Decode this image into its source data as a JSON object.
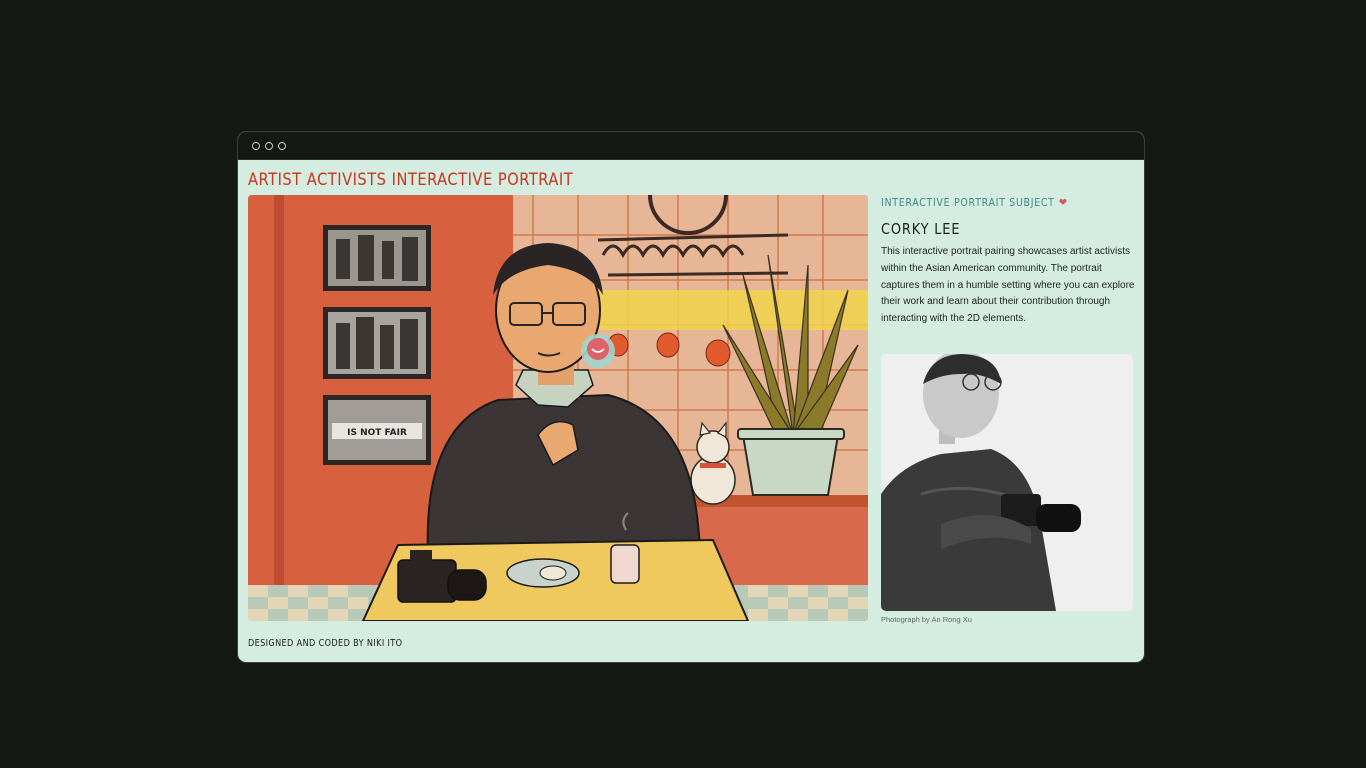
{
  "window": {
    "title": "ARTIST ACTIVISTS INTERACTIVE PORTRAIT",
    "footer": "DESIGNED AND CODED BY NIKI ITO"
  },
  "portrait_illustration": {
    "hotspot_icon": "heart-hotspot-icon",
    "protest_banner_text": "IS NOT FAIR"
  },
  "sidebar": {
    "label": "INTERACTIVE PORTRAIT SUBJECT",
    "label_icon": "heart-icon",
    "name": "CORKY LEE",
    "description": "This interactive portrait pairing showcases artist activists within the Asian American community. The portrait captures them in a humble setting where you can explore their work and learn about their contribution through interacting with the 2D elements.",
    "photo_credit": "Photograph by An Rong Xu"
  },
  "colors": {
    "background": "#141913",
    "panel": "#d5ece1",
    "title_accent": "#c9351d",
    "label_accent": "#3f8a86",
    "heart": "#d8545b"
  }
}
